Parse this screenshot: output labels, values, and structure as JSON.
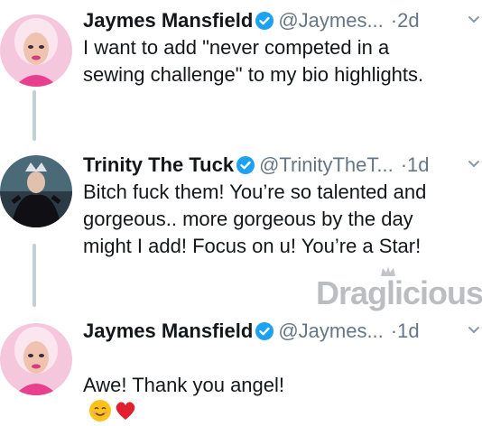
{
  "tweets": [
    {
      "name": "Jaymes Mansfield",
      "handle": "@Jaymes...",
      "separator": "·",
      "time": "2d",
      "text": "I want to add \"never competed in a\nsewing challenge\" to my bio highlights."
    },
    {
      "name": "Trinity The Tuck",
      "handle": "@TrinityTheT...",
      "separator": "·",
      "time": "1d",
      "text": "Bitch fuck them! You’re so talented and\ngorgeous.. more gorgeous by the day\nmight I add! Focus on u! You’re a Star!"
    },
    {
      "name": "Jaymes Mansfield",
      "handle": "@Jaymes...",
      "separator": "·",
      "time": "1d",
      "text": "Awe! Thank you angel!"
    }
  ],
  "watermark": {
    "text": "Draglicious"
  },
  "colors": {
    "name": "#14171a",
    "secondary": "#657786",
    "verified": "#1da1f2",
    "thread_line": "#c4cfd6"
  },
  "icons": {
    "verified": "verified-badge-icon",
    "menu": "chevron-down-icon",
    "emoji_1": "smiling-face-emoji",
    "emoji_2": "red-heart-emoji"
  }
}
